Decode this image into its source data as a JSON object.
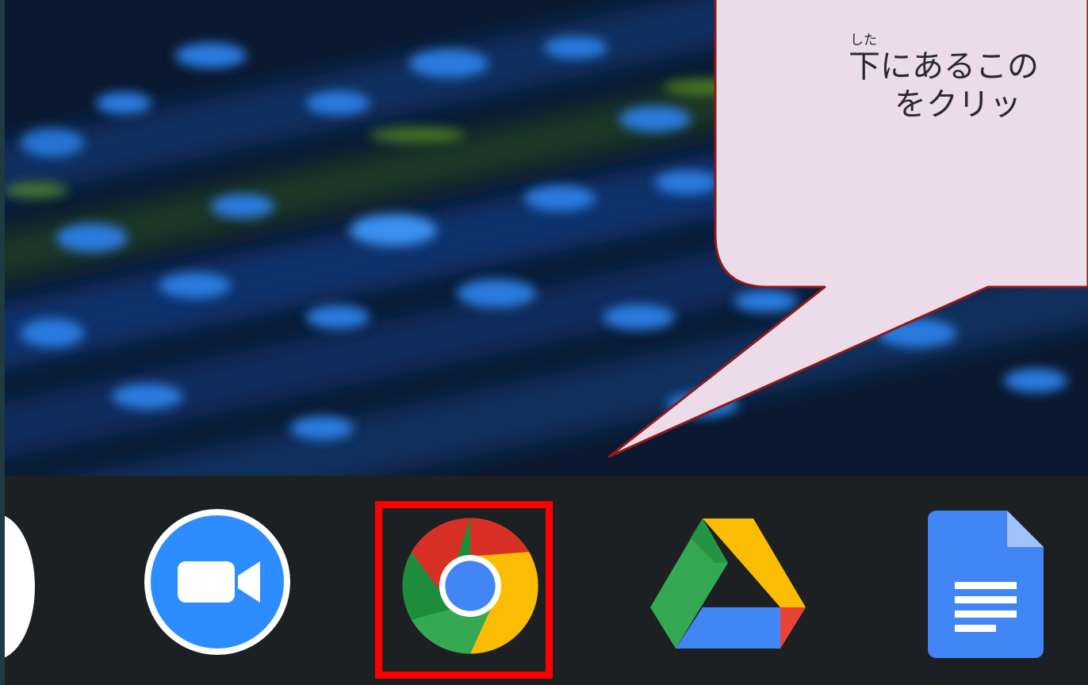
{
  "callout": {
    "ruby_base": "下",
    "ruby_reading": "した",
    "line1_rest": "にあるこの",
    "line2": "をクリッ",
    "fill_color": "#ecdcea",
    "border_color": "#8b1a1a"
  },
  "shelf": {
    "apps": [
      {
        "name": "launcher",
        "icon": "white-circle-icon"
      },
      {
        "name": "zoom",
        "icon": "zoom-icon"
      },
      {
        "name": "chrome",
        "icon": "chrome-icon",
        "highlighted": true
      },
      {
        "name": "drive",
        "icon": "google-drive-icon"
      },
      {
        "name": "docs",
        "icon": "google-docs-icon"
      }
    ],
    "highlight_color": "#ff0000"
  }
}
